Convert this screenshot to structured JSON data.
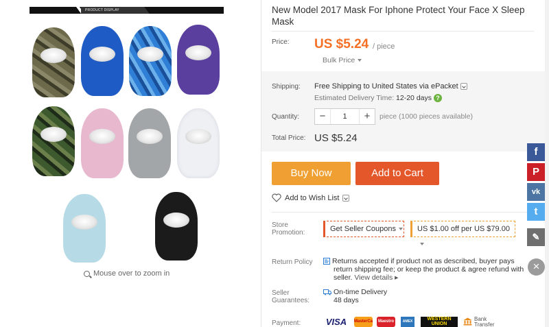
{
  "gallery": {
    "banner_label": "PRODUCT DISPLAY",
    "zoom_hint": "Mouse over to zoom in",
    "masks": [
      {
        "name": "camo-brown-mask",
        "color": "#6d6a4c"
      },
      {
        "name": "royal-blue-mask",
        "color": "#1f5bc4"
      },
      {
        "name": "digital-blue-camo-mask",
        "color": "#2f7fd6"
      },
      {
        "name": "purple-mask",
        "color": "#5a3f9e"
      },
      {
        "name": "green-camo-mask",
        "color": "#3d5a2e"
      },
      {
        "name": "pink-mask",
        "color": "#e8b8cf"
      },
      {
        "name": "gray-mask",
        "color": "#a3a6a8"
      },
      {
        "name": "white-mask",
        "color": "#f0f0f4"
      },
      {
        "name": "light-blue-mask",
        "color": "#b7dbe6"
      },
      {
        "name": "black-mask",
        "color": "#1b1b1b"
      }
    ]
  },
  "product": {
    "title": "New Model 2017 Mask For Iphone Protect Your Face X Sleep Mask",
    "price_label": "Price:",
    "price": "US $5.24",
    "per_unit": "/ piece",
    "bulk_price": "Bulk Price",
    "shipping_label": "Shipping:",
    "shipping_text": "Free Shipping to United States via ePacket",
    "delivery_label": "Estimated Delivery Time:",
    "delivery_value": "12-20 days",
    "quantity_label": "Quantity:",
    "quantity_value": "1",
    "quantity_note": "piece (1000 pieces available)",
    "minus": "−",
    "plus": "+",
    "total_label": "Total Price:",
    "total_value": "US $5.24",
    "buy_now": "Buy Now",
    "add_to_cart": "Add to Cart",
    "wish_list": "Add to Wish List",
    "store_promotion_label_1": "Store",
    "store_promotion_label_2": "Promotion:",
    "coupon_1": "Get Seller Coupons",
    "coupon_2": "US $1.00 off per US $79.00",
    "return_label": "Return Policy",
    "return_line_1": "Returns accepted if product not as described, buyer pays",
    "return_line_2": "return shipping fee; or keep the product & agree refund with",
    "return_line_3": "seller.",
    "view_details": "View details",
    "guarantee_label_1": "Seller",
    "guarantee_label_2": "Guarantees:",
    "guarantee_line_1": "On-time Delivery",
    "guarantee_line_2": "48 days",
    "payment_label": "Payment:",
    "payment_methods": [
      "VISA",
      "MasterCard",
      "Maestro",
      "AMEX",
      "WESTERN UNION",
      "Bank Transfer"
    ]
  },
  "social": [
    "f",
    "P",
    "vk",
    "t",
    "✎"
  ],
  "colors": {
    "price": "#f56f25",
    "buy_now": "#f0a033",
    "add_to_cart": "#e4572b",
    "facebook": "#3b5998",
    "pinterest": "#cb2027",
    "vk": "#4c75a3",
    "twitter": "#55acee",
    "edit": "#6f6f6f"
  }
}
